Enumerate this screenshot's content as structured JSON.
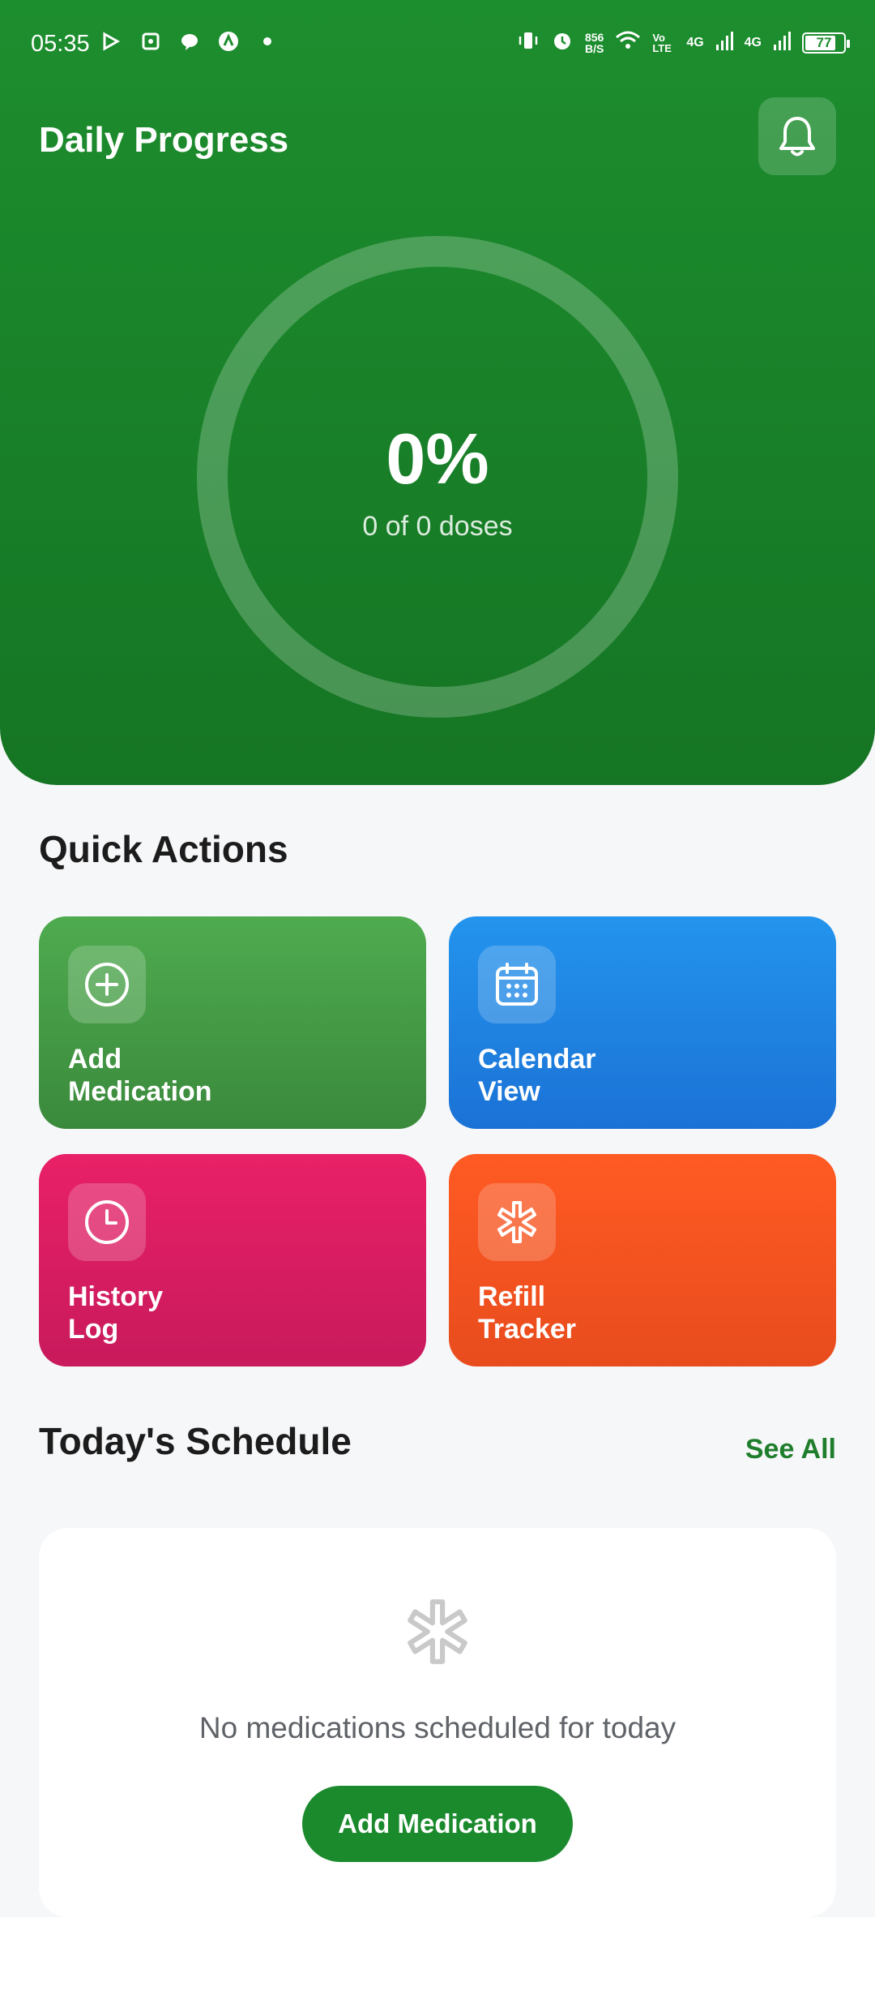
{
  "status_bar": {
    "time": "05:35",
    "speed_value": "856",
    "speed_unit": "B/S",
    "net1": "4G",
    "net2": "4G",
    "volte": "Vo LTE",
    "battery": "77",
    "left_icons": [
      "media-icon",
      "screenshot-icon",
      "chat-icon",
      "app-icon",
      "dot-icon"
    ],
    "right_icons": [
      "vibrate-icon",
      "alarm-icon",
      "wifi-icon",
      "signal-icon",
      "signal-icon"
    ]
  },
  "header": {
    "title": "Daily Progress",
    "bell_icon": "bell-icon",
    "progress_percent": "0%",
    "progress_value": 0,
    "doses_text": "0 of 0 doses"
  },
  "quick_actions": {
    "title": "Quick Actions",
    "items": [
      {
        "line1": "Add",
        "line2": "Medication",
        "icon": "add-circle-icon",
        "color": "#4caf50"
      },
      {
        "line1": "Calendar",
        "line2": "View",
        "icon": "calendar-icon",
        "color": "#2196f3"
      },
      {
        "line1": "History",
        "line2": "Log",
        "icon": "clock-icon",
        "color": "#e91e63"
      },
      {
        "line1": "Refill",
        "line2": "Tracker",
        "icon": "medical-icon",
        "color": "#ff5722"
      }
    ]
  },
  "schedule": {
    "title": "Today's Schedule",
    "see_all": "See All",
    "empty_text": "No medications scheduled for today",
    "add_button": "Add Medication",
    "empty_icon": "medical-icon"
  },
  "colors": {
    "brand_green": "#1b8a2d",
    "see_all_green": "#1f7e2c"
  }
}
